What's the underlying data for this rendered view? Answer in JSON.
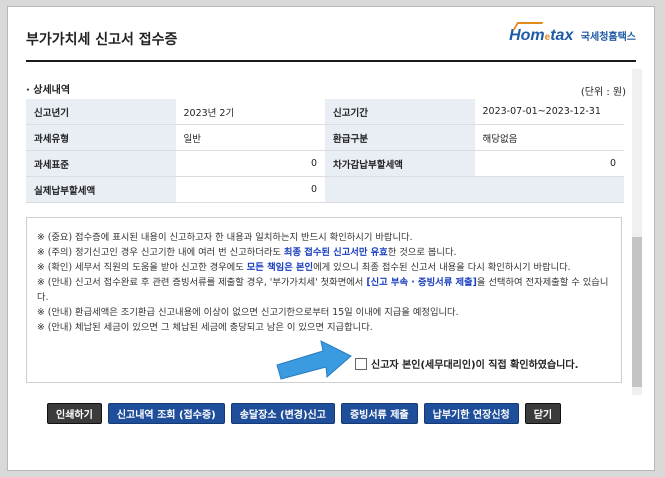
{
  "dialog": {
    "title": "부가가치세 신고서 접수증",
    "logo": {
      "home": "Hom",
      "tax": "tax",
      "sub": "국세청홈택스"
    }
  },
  "section": {
    "title": "· 상세내역",
    "unit": "(단위 : 원)"
  },
  "details": [
    {
      "label1": "신고년기",
      "value1": "2023년 2기",
      "label2": "신고기간",
      "value2": "2023-07-01~2023-12-31"
    },
    {
      "label1": "과세유형",
      "value1": "일반",
      "label2": "환급구분",
      "value2": "해당없음"
    },
    {
      "label1": "과세표준",
      "value1": "0",
      "label2": "차가감납부할세액",
      "value2": "0"
    },
    {
      "label1": "실제납부할세액",
      "value1": "0",
      "label2": "",
      "value2": ""
    }
  ],
  "notices": [
    {
      "pre": "※ (중요) 접수증에 표시된 내용이 신고하고자 한 내용과 일치하는지 반드시 확인하시기 바랍니다.",
      "hl": "",
      "post": ""
    },
    {
      "pre": "※ (주의) 정기신고인 경우 신고기한 내에 여러 번 신고하더라도 ",
      "hl": "최종 접수된 신고서만 유효",
      "post": "한 것으로 봅니다."
    },
    {
      "pre": "※ (확인) 세무서 직원의 도움을 받아 신고한 경우에도 ",
      "hl": "모든 책임은 본인",
      "post": "에게 있으니 최종 접수된 신고서 내용을 다시 확인하시기 바랍니다."
    },
    {
      "pre": "※ (안내) 신고서 접수완료 후 관련 증빙서류를 제출할 경우, '부가가치세' 첫화면에서 ",
      "hl": "[신고 부속 · 증빙서류 제출]",
      "post": "을 선택하여 전자제출할 수 있습니다."
    },
    {
      "pre": "※ (안내) 환급세액은 조기환급 신고내용에 이상이 없으면 신고기한으로부터 15일 이내에 지급을 예정입니다.",
      "hl": "",
      "post": ""
    },
    {
      "pre": "※ (안내) 체납된 세금이 있으면 그 체납된 세금에 충당되고 남은 ",
      "hl": "",
      "post": "이 있으면 지급합니다."
    }
  ],
  "confirm_label": "신고자 본인(세무대리인)이 직접 확인하였습니다.",
  "buttons": [
    {
      "label": "인쇄하기",
      "style": "dark"
    },
    {
      "label": "신고내역 조회 (접수증)",
      "style": "blue"
    },
    {
      "label": "송달장소 (변경)신고",
      "style": "blue"
    },
    {
      "label": "증빙서류 제출",
      "style": "blue"
    },
    {
      "label": "납부기한 연장신청",
      "style": "blue"
    },
    {
      "label": "닫기",
      "style": "dark"
    }
  ]
}
